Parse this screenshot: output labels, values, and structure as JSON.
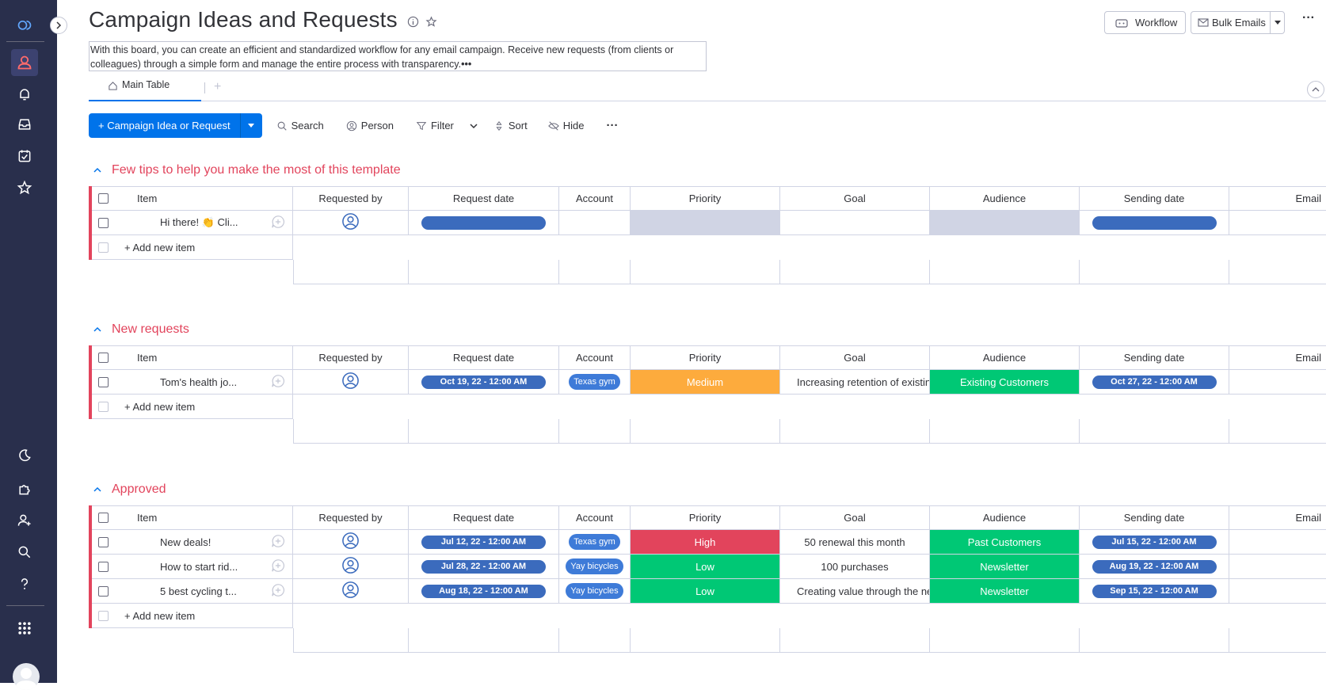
{
  "board": {
    "title": "Campaign Ideas and Requests",
    "description_line1": "With this board, you can create an efficient and standardized workflow for any email campaign. Receive new requests (from clients or",
    "description_line2": "colleagues) through a simple form and manage the entire process with transparency.",
    "description_more": "•••"
  },
  "top_buttons": {
    "workflow": "Workflow",
    "bulk_emails": "Bulk Emails",
    "more": "···"
  },
  "tabs": {
    "main": "Main Table",
    "add": "+"
  },
  "toolbar": {
    "new_item": "+ Campaign Idea or Request",
    "search": "Search",
    "person": "Person",
    "filter": "Filter",
    "sort": "Sort",
    "hide": "Hide",
    "more": "···"
  },
  "columns": {
    "item": "Item",
    "requested_by": "Requested by",
    "request_date": "Request date",
    "account": "Account",
    "priority": "Priority",
    "goal": "Goal",
    "audience": "Audience",
    "sending_date": "Sending date",
    "email": "Email"
  },
  "add_item_label": "+ Add new item",
  "groups": [
    {
      "title": "Few tips to help you make the most of this template",
      "rows": [
        {
          "item": "Hi there! 👏 Cli...",
          "request_date": "",
          "account": "",
          "priority": "",
          "priority_color": "#d0d4e4",
          "goal": "",
          "audience": "",
          "audience_color": "#d0d4e4",
          "sending_date": ""
        }
      ]
    },
    {
      "title": "New requests",
      "rows": [
        {
          "item": "Tom's health jo...",
          "request_date": "Oct 19, 22 - 12:00 AM",
          "account": "Texas gym",
          "priority": "Medium",
          "priority_color": "#fdab3d",
          "goal": "Increasing retention of existing",
          "audience": "Existing Customers",
          "audience_color": "#00c875",
          "sending_date": "Oct 27, 22 - 12:00 AM"
        }
      ]
    },
    {
      "title": "Approved",
      "rows": [
        {
          "item": "New deals!",
          "request_date": "Jul 12, 22 - 12:00 AM",
          "account": "Texas gym",
          "priority": "High",
          "priority_color": "#e2445c",
          "goal": "50 renewal this month",
          "audience": "Past Customers",
          "audience_color": "#00c875",
          "sending_date": "Jul 15, 22 - 12:00 AM"
        },
        {
          "item": "How to start rid...",
          "request_date": "Jul 28, 22 - 12:00 AM",
          "account": "Yay bicycles",
          "priority": "Low",
          "priority_color": "#00c875",
          "goal": "100 purchases",
          "audience": "Newsletter",
          "audience_color": "#00c875",
          "sending_date": "Aug 19, 22 - 12:00 AM"
        },
        {
          "item": "5 best cycling t...",
          "request_date": "Aug 18, 22 - 12:00 AM",
          "account": "Yay bicycles",
          "priority": "Low",
          "priority_color": "#00c875",
          "goal": "Creating value through the ne",
          "audience": "Newsletter",
          "audience_color": "#00c875",
          "sending_date": "Sep 15, 22 - 12:00 AM"
        }
      ]
    }
  ],
  "colors": {
    "accent": "#0073ea",
    "group_title": "#e2445c",
    "sidebar": "#292f4c",
    "date_pill": "#3b6bbd",
    "account_pill": "#3e7bd8"
  }
}
